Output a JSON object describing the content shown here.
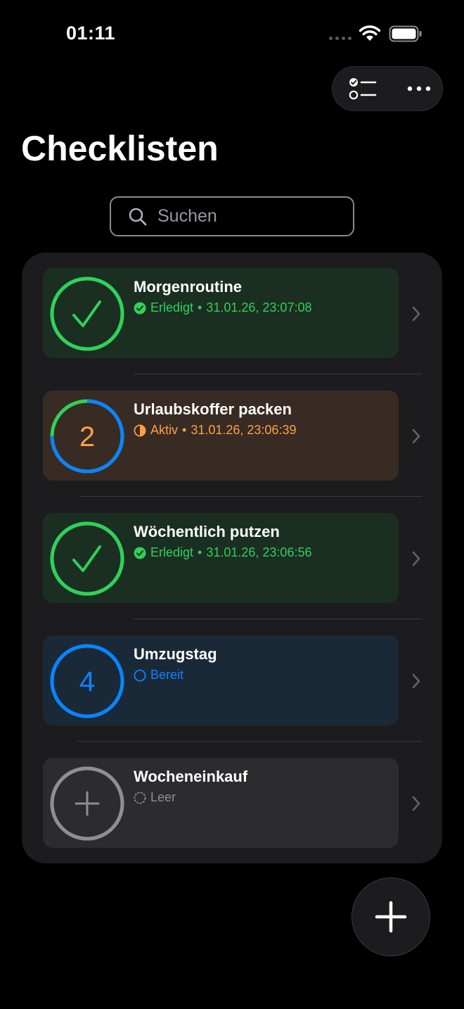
{
  "status_bar": {
    "time": "01:11"
  },
  "toolbar": {
    "checklist_icon": "checklist-icon",
    "more_icon": "ellipsis-icon"
  },
  "page": {
    "title": "Checklisten"
  },
  "search": {
    "placeholder": "Suchen",
    "value": ""
  },
  "separator": "•",
  "checklists": [
    {
      "title": "Morgenroutine",
      "state": "Erledigt",
      "timestamp": "31.01.26, 23:07:08",
      "ring_symbol": "checkmark-icon",
      "status_icon": "checkmark-circle-icon",
      "accent": "#30d158",
      "tile_color": "#1b2e22",
      "progress": 1.0
    },
    {
      "title": "Urlaubskoffer packen",
      "state": "Aktiv",
      "timestamp": "31.01.26, 23:06:39",
      "ring_number": "2",
      "status_icon": "half-circle-icon",
      "accent": "#ff9f45",
      "tile_color": "#382b23",
      "progress": 0.75
    },
    {
      "title": "Wöchentlich putzen",
      "state": "Erledigt",
      "timestamp": "31.01.26, 23:06:56",
      "ring_symbol": "checkmark-icon",
      "status_icon": "checkmark-circle-icon",
      "accent": "#30d158",
      "tile_color": "#1b2e22",
      "progress": 1.0
    },
    {
      "title": "Umzugstag",
      "state": "Bereit",
      "ring_number": "4",
      "status_icon": "empty-circle-icon",
      "accent": "#0a84ff",
      "tile_color": "#1a2938",
      "progress": 1.0
    },
    {
      "title": "Wocheneinkauf",
      "state": "Leer",
      "ring_symbol": "plus-icon",
      "status_icon": "dashed-circle-icon",
      "accent": "#8e8e93",
      "tile_color": "#2c2c2e",
      "progress": 1.0
    }
  ],
  "fab": {
    "icon": "plus-icon"
  }
}
